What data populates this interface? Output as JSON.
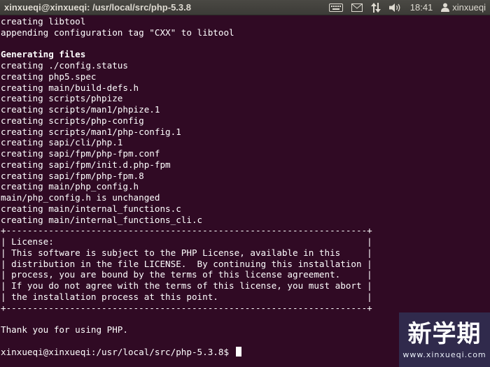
{
  "topbar": {
    "window_title": "xinxueqi@xinxueqi: /usr/local/src/php-5.3.8",
    "indicators": [
      {
        "icon": "keyboard-icon"
      },
      {
        "icon": "mail-icon"
      },
      {
        "icon": "network-icon"
      },
      {
        "icon": "volume-icon"
      }
    ],
    "clock": "18:41",
    "user_icon": "user-icon",
    "user_name": "xinxueqi"
  },
  "terminal": {
    "lines": [
      {
        "text": "creating libtool",
        "bold": false
      },
      {
        "text": "appending configuration tag \"CXX\" to libtool",
        "bold": false
      },
      {
        "text": "",
        "bold": false
      },
      {
        "text": "Generating files",
        "bold": true
      },
      {
        "text": "creating ./config.status",
        "bold": false
      },
      {
        "text": "creating php5.spec",
        "bold": false
      },
      {
        "text": "creating main/build-defs.h",
        "bold": false
      },
      {
        "text": "creating scripts/phpize",
        "bold": false
      },
      {
        "text": "creating scripts/man1/phpize.1",
        "bold": false
      },
      {
        "text": "creating scripts/php-config",
        "bold": false
      },
      {
        "text": "creating scripts/man1/php-config.1",
        "bold": false
      },
      {
        "text": "creating sapi/cli/php.1",
        "bold": false
      },
      {
        "text": "creating sapi/fpm/php-fpm.conf",
        "bold": false
      },
      {
        "text": "creating sapi/fpm/init.d.php-fpm",
        "bold": false
      },
      {
        "text": "creating sapi/fpm/php-fpm.8",
        "bold": false
      },
      {
        "text": "creating main/php_config.h",
        "bold": false
      },
      {
        "text": "main/php_config.h is unchanged",
        "bold": false
      },
      {
        "text": "creating main/internal_functions.c",
        "bold": false
      },
      {
        "text": "creating main/internal_functions_cli.c",
        "bold": false
      },
      {
        "text": "+--------------------------------------------------------------------+",
        "bold": false
      },
      {
        "text": "| License:                                                           |",
        "bold": false
      },
      {
        "text": "| This software is subject to the PHP License, available in this     |",
        "bold": false
      },
      {
        "text": "| distribution in the file LICENSE.  By continuing this installation |",
        "bold": false
      },
      {
        "text": "| process, you are bound by the terms of this license agreement.     |",
        "bold": false
      },
      {
        "text": "| If you do not agree with the terms of this license, you must abort |",
        "bold": false
      },
      {
        "text": "| the installation process at this point.                            |",
        "bold": false
      },
      {
        "text": "+--------------------------------------------------------------------+",
        "bold": false
      },
      {
        "text": "",
        "bold": false
      },
      {
        "text": "Thank you for using PHP.",
        "bold": false
      },
      {
        "text": "",
        "bold": false
      },
      {
        "text": "xinxueqi@xinxueqi:/usr/local/src/php-5.3.8$ ",
        "bold": false,
        "cursor": true
      }
    ]
  },
  "watermark": {
    "logo": "新学期",
    "url": "www.xinxueqi.com"
  },
  "colors": {
    "terminal_bg": "#300a24",
    "terminal_fg": "#ffffff",
    "panel_bg": "#3c3b37",
    "panel_fg": "#dfdbd2"
  }
}
